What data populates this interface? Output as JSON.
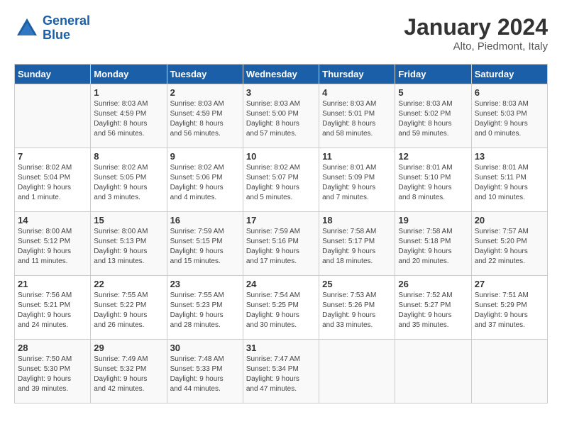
{
  "header": {
    "logo_line1": "General",
    "logo_line2": "Blue",
    "month": "January 2024",
    "location": "Alto, Piedmont, Italy"
  },
  "days_of_week": [
    "Sunday",
    "Monday",
    "Tuesday",
    "Wednesday",
    "Thursday",
    "Friday",
    "Saturday"
  ],
  "weeks": [
    [
      {
        "num": "",
        "info": ""
      },
      {
        "num": "1",
        "info": "Sunrise: 8:03 AM\nSunset: 4:59 PM\nDaylight: 8 hours\nand 56 minutes."
      },
      {
        "num": "2",
        "info": "Sunrise: 8:03 AM\nSunset: 4:59 PM\nDaylight: 8 hours\nand 56 minutes."
      },
      {
        "num": "3",
        "info": "Sunrise: 8:03 AM\nSunset: 5:00 PM\nDaylight: 8 hours\nand 57 minutes."
      },
      {
        "num": "4",
        "info": "Sunrise: 8:03 AM\nSunset: 5:01 PM\nDaylight: 8 hours\nand 58 minutes."
      },
      {
        "num": "5",
        "info": "Sunrise: 8:03 AM\nSunset: 5:02 PM\nDaylight: 8 hours\nand 59 minutes."
      },
      {
        "num": "6",
        "info": "Sunrise: 8:03 AM\nSunset: 5:03 PM\nDaylight: 9 hours\nand 0 minutes."
      }
    ],
    [
      {
        "num": "7",
        "info": "Sunrise: 8:02 AM\nSunset: 5:04 PM\nDaylight: 9 hours\nand 1 minute."
      },
      {
        "num": "8",
        "info": "Sunrise: 8:02 AM\nSunset: 5:05 PM\nDaylight: 9 hours\nand 3 minutes."
      },
      {
        "num": "9",
        "info": "Sunrise: 8:02 AM\nSunset: 5:06 PM\nDaylight: 9 hours\nand 4 minutes."
      },
      {
        "num": "10",
        "info": "Sunrise: 8:02 AM\nSunset: 5:07 PM\nDaylight: 9 hours\nand 5 minutes."
      },
      {
        "num": "11",
        "info": "Sunrise: 8:01 AM\nSunset: 5:09 PM\nDaylight: 9 hours\nand 7 minutes."
      },
      {
        "num": "12",
        "info": "Sunrise: 8:01 AM\nSunset: 5:10 PM\nDaylight: 9 hours\nand 8 minutes."
      },
      {
        "num": "13",
        "info": "Sunrise: 8:01 AM\nSunset: 5:11 PM\nDaylight: 9 hours\nand 10 minutes."
      }
    ],
    [
      {
        "num": "14",
        "info": "Sunrise: 8:00 AM\nSunset: 5:12 PM\nDaylight: 9 hours\nand 11 minutes."
      },
      {
        "num": "15",
        "info": "Sunrise: 8:00 AM\nSunset: 5:13 PM\nDaylight: 9 hours\nand 13 minutes."
      },
      {
        "num": "16",
        "info": "Sunrise: 7:59 AM\nSunset: 5:15 PM\nDaylight: 9 hours\nand 15 minutes."
      },
      {
        "num": "17",
        "info": "Sunrise: 7:59 AM\nSunset: 5:16 PM\nDaylight: 9 hours\nand 17 minutes."
      },
      {
        "num": "18",
        "info": "Sunrise: 7:58 AM\nSunset: 5:17 PM\nDaylight: 9 hours\nand 18 minutes."
      },
      {
        "num": "19",
        "info": "Sunrise: 7:58 AM\nSunset: 5:18 PM\nDaylight: 9 hours\nand 20 minutes."
      },
      {
        "num": "20",
        "info": "Sunrise: 7:57 AM\nSunset: 5:20 PM\nDaylight: 9 hours\nand 22 minutes."
      }
    ],
    [
      {
        "num": "21",
        "info": "Sunrise: 7:56 AM\nSunset: 5:21 PM\nDaylight: 9 hours\nand 24 minutes."
      },
      {
        "num": "22",
        "info": "Sunrise: 7:55 AM\nSunset: 5:22 PM\nDaylight: 9 hours\nand 26 minutes."
      },
      {
        "num": "23",
        "info": "Sunrise: 7:55 AM\nSunset: 5:23 PM\nDaylight: 9 hours\nand 28 minutes."
      },
      {
        "num": "24",
        "info": "Sunrise: 7:54 AM\nSunset: 5:25 PM\nDaylight: 9 hours\nand 30 minutes."
      },
      {
        "num": "25",
        "info": "Sunrise: 7:53 AM\nSunset: 5:26 PM\nDaylight: 9 hours\nand 33 minutes."
      },
      {
        "num": "26",
        "info": "Sunrise: 7:52 AM\nSunset: 5:27 PM\nDaylight: 9 hours\nand 35 minutes."
      },
      {
        "num": "27",
        "info": "Sunrise: 7:51 AM\nSunset: 5:29 PM\nDaylight: 9 hours\nand 37 minutes."
      }
    ],
    [
      {
        "num": "28",
        "info": "Sunrise: 7:50 AM\nSunset: 5:30 PM\nDaylight: 9 hours\nand 39 minutes."
      },
      {
        "num": "29",
        "info": "Sunrise: 7:49 AM\nSunset: 5:32 PM\nDaylight: 9 hours\nand 42 minutes."
      },
      {
        "num": "30",
        "info": "Sunrise: 7:48 AM\nSunset: 5:33 PM\nDaylight: 9 hours\nand 44 minutes."
      },
      {
        "num": "31",
        "info": "Sunrise: 7:47 AM\nSunset: 5:34 PM\nDaylight: 9 hours\nand 47 minutes."
      },
      {
        "num": "",
        "info": ""
      },
      {
        "num": "",
        "info": ""
      },
      {
        "num": "",
        "info": ""
      }
    ]
  ]
}
